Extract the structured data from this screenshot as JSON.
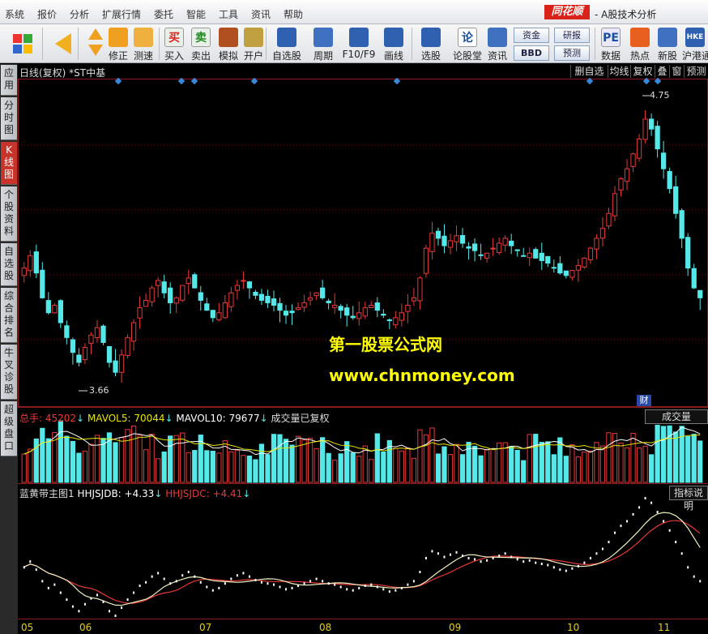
{
  "menu": {
    "items": [
      "系统",
      "报价",
      "分析",
      "扩展行情",
      "委托",
      "智能",
      "工具",
      "资讯",
      "帮助"
    ],
    "logo": "同花顺",
    "app_title": "- A股技术分析"
  },
  "toolbar": {
    "buttons": [
      {
        "label": "修正",
        "icon": "refresh-icon"
      },
      {
        "label": "测速",
        "icon": "clock-icon"
      },
      {
        "label": "买入",
        "icon": "buy-icon",
        "glyph": "买"
      },
      {
        "label": "卖出",
        "icon": "sell-icon",
        "glyph": "卖"
      },
      {
        "label": "模拟",
        "icon": "hammer-icon"
      },
      {
        "label": "开户",
        "icon": "lock-icon"
      },
      {
        "label": "自选股",
        "icon": "star-icon"
      },
      {
        "label": "周期",
        "icon": "cycle-icon"
      },
      {
        "label": "F10/F9",
        "icon": "f10-icon"
      },
      {
        "label": "画线",
        "icon": "pen-icon"
      },
      {
        "label": "选股",
        "icon": "select-icon"
      },
      {
        "label": "论股堂",
        "icon": "lun-icon",
        "glyph": "论"
      },
      {
        "label": "资讯",
        "icon": "news-icon"
      },
      {
        "label": "数据",
        "icon": "pe-icon",
        "glyph": "PE"
      },
      {
        "label": "热点",
        "icon": "hot-icon"
      },
      {
        "label": "新股",
        "icon": "newstock-icon"
      },
      {
        "label": "沪港通",
        "icon": "hkex-icon",
        "glyph": "HKE"
      }
    ],
    "small_buttons": [
      "资金",
      "BBD",
      "研报",
      "预测"
    ]
  },
  "left_tabs": [
    {
      "label": "应用"
    },
    {
      "label": "分时图"
    },
    {
      "label": "K线图",
      "active": true
    },
    {
      "label": "个股资料"
    },
    {
      "label": "自选股"
    },
    {
      "label": "综合排名"
    },
    {
      "label": "牛叉诊股"
    },
    {
      "label": "超级盘口"
    }
  ],
  "chart_header": {
    "title": "日线(复权) *ST中基",
    "buttons": [
      "删自选",
      "均线",
      "复权",
      "叠",
      "窗",
      "预测"
    ]
  },
  "price_labels": {
    "high": "4.75",
    "low": "3.66"
  },
  "watermark": {
    "line1": "第一股票公式网",
    "line2": "www.chnmoney.com"
  },
  "financial_badge": "财",
  "volume_panel": {
    "total_label": "总手: 45202",
    "mavol5": "MAVOL5: 70044",
    "mavol10": "MAVOL10: 79677",
    "note": "成交量已复权",
    "right_box": "成交量"
  },
  "indicator_panel": {
    "name": "蓝黄带主图1",
    "hhjsjdb": "HHJSJDB: +4.33",
    "hhjsjdc": "HHJSJDC: +4.41",
    "right_box": "指标说明"
  },
  "x_axis_labels": [
    "05",
    "06",
    "07",
    "08",
    "09",
    "10",
    "11"
  ],
  "colors": {
    "up": "#e83a3a",
    "down": "#54e8e8",
    "ma_yellow": "#e8e800",
    "ma_white": "#ffffff",
    "panel_border": "#8b1a1a"
  },
  "chart_data": {
    "type": "candlestick",
    "title": "日线(复权) *ST中基",
    "price_range": [
      3.55,
      4.85
    ],
    "price_high": 4.75,
    "price_low": 3.66,
    "close_series": [
      4.1,
      4.15,
      4.08,
      3.98,
      3.92,
      3.95,
      3.88,
      3.82,
      3.76,
      3.72,
      3.78,
      3.83,
      3.86,
      3.8,
      3.72,
      3.68,
      3.75,
      3.82,
      3.88,
      3.94,
      3.97,
      4.02,
      4.05,
      4.0,
      3.96,
      3.98,
      4.03,
      4.06,
      4.02,
      3.97,
      3.93,
      3.9,
      3.92,
      3.96,
      4.0,
      4.03,
      4.05,
      4.02,
      3.99,
      3.97,
      3.96,
      3.95,
      3.93,
      3.91,
      3.92,
      3.94,
      3.96,
      3.98,
      4.0,
      3.98,
      3.96,
      3.95,
      3.93,
      3.91,
      3.9,
      3.92,
      3.94,
      3.95,
      3.93,
      3.91,
      3.89,
      3.9,
      3.92,
      3.95,
      3.98,
      4.06,
      4.18,
      4.24,
      4.22,
      4.19,
      4.21,
      4.23,
      4.2,
      4.18,
      4.17,
      4.15,
      4.16,
      4.18,
      4.2,
      4.22,
      4.19,
      4.17,
      4.15,
      4.16,
      4.14,
      4.13,
      4.12,
      4.1,
      4.08,
      4.07,
      4.09,
      4.11,
      4.14,
      4.18,
      4.22,
      4.26,
      4.32,
      4.4,
      4.46,
      4.5,
      4.56,
      4.62,
      4.7,
      4.66,
      4.58,
      4.5,
      4.42,
      4.32,
      4.22,
      4.1,
      4.02,
      3.98
    ]
  }
}
